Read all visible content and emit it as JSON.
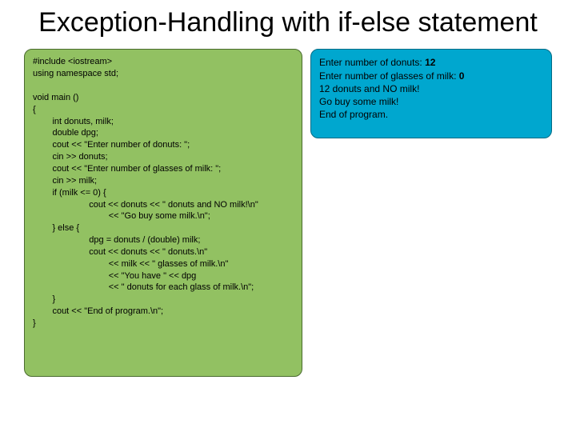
{
  "title": "Exception-Handling with if-else statement",
  "code": "#include <iostream>\nusing namespace std;\n\nvoid main ()\n{\n        int donuts, milk;\n        double dpg;\n        cout << \"Enter number of donuts: \";\n        cin >> donuts;\n        cout << \"Enter number of glasses of milk: \";\n        cin >> milk;\n        if (milk <= 0) {\n                       cout << donuts << \" donuts and NO milk!\\n\"\n                               << \"Go buy some milk.\\n\";\n        } else {\n                       dpg = donuts / (double) milk;\n                       cout << donuts << \" donuts.\\n\"\n                               << milk << \" glasses of milk.\\n\"\n                               << \"You have \" << dpg\n                               << \" donuts for each glass of milk.\\n\";\n        }\n        cout << \"End of program.\\n\";\n}",
  "output": {
    "lines": [
      {
        "prefix": "Enter number of donuts: ",
        "bold": "12"
      },
      {
        "prefix": "Enter number of glasses of milk: ",
        "bold": "0"
      },
      {
        "prefix": "12 donuts and NO milk!",
        "bold": ""
      },
      {
        "prefix": "Go buy some milk!",
        "bold": ""
      },
      {
        "prefix": "End of program.",
        "bold": ""
      }
    ]
  }
}
